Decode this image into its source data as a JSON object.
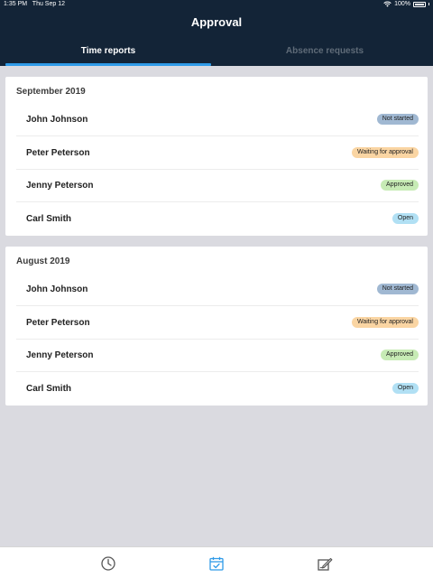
{
  "status_bar": {
    "time": "1:35 PM",
    "date": "Thu Sep 12",
    "battery": "100%"
  },
  "header": {
    "title": "Approval"
  },
  "tabs": [
    {
      "label": "Time reports",
      "active": true
    },
    {
      "label": "Absence requests",
      "active": false
    }
  ],
  "sections": [
    {
      "title": "September 2019",
      "rows": [
        {
          "name": "John Johnson",
          "status": "Not started"
        },
        {
          "name": "Peter Peterson",
          "status": "Waiting for approval"
        },
        {
          "name": "Jenny Peterson",
          "status": "Approved"
        },
        {
          "name": "Carl Smith",
          "status": "Open"
        }
      ]
    },
    {
      "title": "August 2019",
      "rows": [
        {
          "name": "John Johnson",
          "status": "Not started"
        },
        {
          "name": "Peter Peterson",
          "status": "Waiting for approval"
        },
        {
          "name": "Jenny Peterson",
          "status": "Approved"
        },
        {
          "name": "Carl Smith",
          "status": "Open"
        }
      ]
    }
  ],
  "colors": {
    "header": "#132437",
    "tab_indicator": "#2f9be8",
    "not_started": "#a0b8d2",
    "waiting": "#fad5a3",
    "approved": "#c7ebb5",
    "open": "#b1e0f4",
    "nav_active": "#2f9be8"
  },
  "bottom_nav": [
    {
      "icon": "clock-icon",
      "active": false
    },
    {
      "icon": "calendar-check-icon",
      "active": true
    },
    {
      "icon": "signature-icon",
      "active": false
    }
  ]
}
